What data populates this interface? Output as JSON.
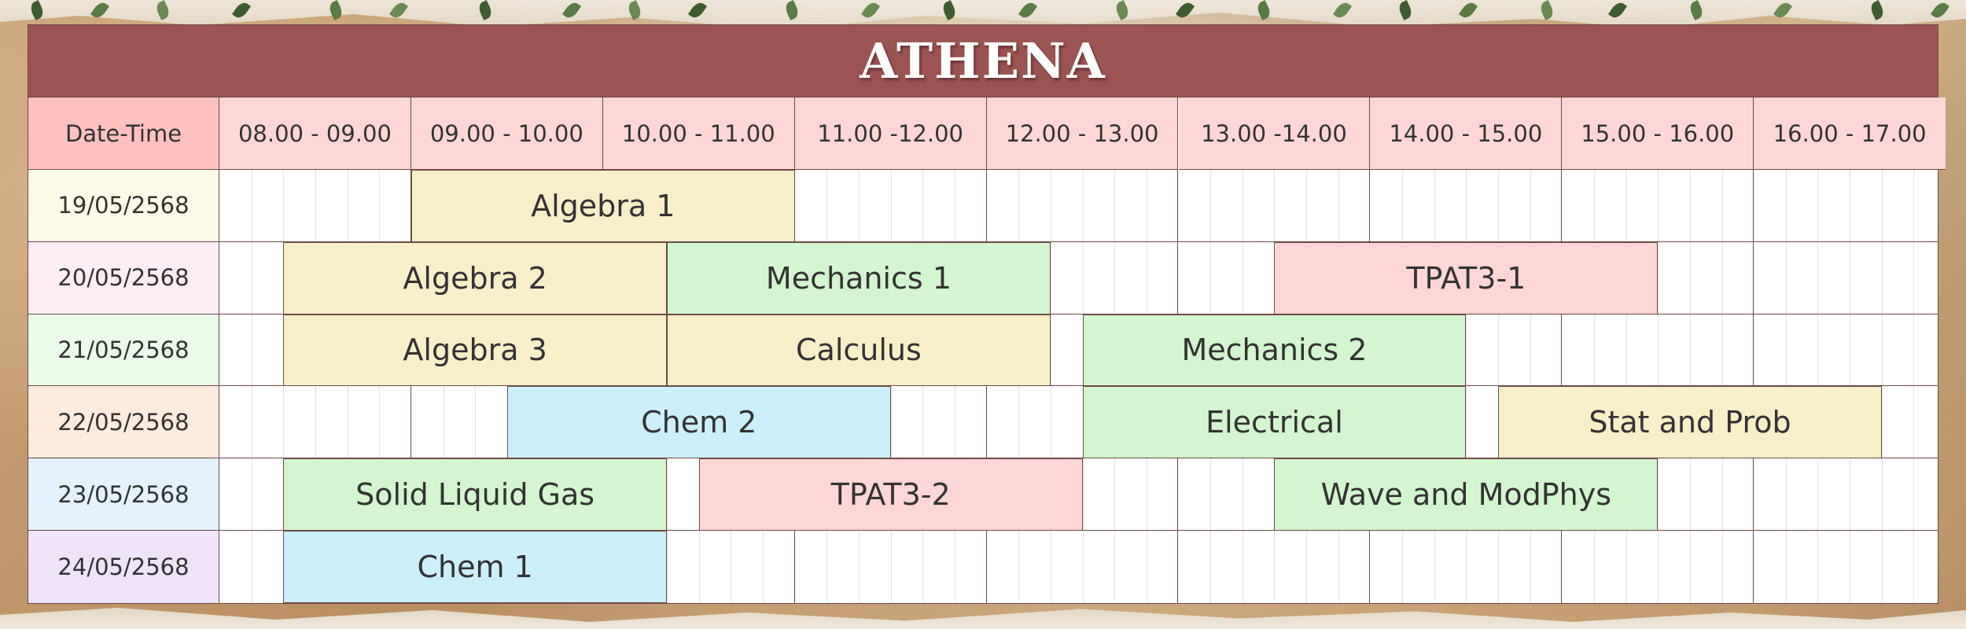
{
  "title": "ATHENA",
  "header": {
    "corner_label": "Date-Time",
    "time_slots": [
      "08.00 - 09.00",
      "09.00 - 10.00",
      "10.00 - 11.00",
      "11.00 -12.00",
      "12.00 - 13.00",
      "13.00 -14.00",
      "14.00 - 15.00",
      "15.00 - 16.00",
      "16.00 - 17.00"
    ]
  },
  "colors": {
    "title_bar": "#9b5452",
    "header": "#ffd6d6",
    "subject_yellow": "#f7efc8",
    "subject_green": "#d3f5cf",
    "subject_pink": "#ffd6d6",
    "subject_blue": "#cbeffb"
  },
  "rows": [
    {
      "date": "19/05/2568",
      "date_color": "#fdfbe8",
      "events": [
        {
          "label": "Algebra 1",
          "start": 9.0,
          "end": 11.0,
          "color": "#f7efc8"
        }
      ]
    },
    {
      "date": "20/05/2568",
      "date_color": "#fdeef6",
      "events": [
        {
          "label": "Algebra 2",
          "start": 8.333,
          "end": 10.333,
          "color": "#f7efc8"
        },
        {
          "label": "Mechanics 1",
          "start": 10.333,
          "end": 12.333,
          "color": "#d3f5cf"
        },
        {
          "label": "TPAT3-1",
          "start": 13.5,
          "end": 15.5,
          "color": "#ffd6d6"
        }
      ]
    },
    {
      "date": "21/05/2568",
      "date_color": "#eafbea",
      "events": [
        {
          "label": "Algebra 3",
          "start": 8.333,
          "end": 10.333,
          "color": "#f7efc8"
        },
        {
          "label": "Calculus",
          "start": 10.333,
          "end": 12.333,
          "color": "#f7efc8"
        },
        {
          "label": "Mechanics 2",
          "start": 12.5,
          "end": 14.5,
          "color": "#d3f5cf"
        }
      ]
    },
    {
      "date": "22/05/2568",
      "date_color": "#fdebde",
      "events": [
        {
          "label": "Chem 2",
          "start": 9.5,
          "end": 11.5,
          "color": "#cbeffb"
        },
        {
          "label": "Electrical",
          "start": 12.5,
          "end": 14.5,
          "color": "#d3f5cf"
        },
        {
          "label": "Stat and Prob",
          "start": 14.667,
          "end": 16.667,
          "color": "#f7efc8"
        }
      ]
    },
    {
      "date": "23/05/2568",
      "date_color": "#e3f2fc",
      "events": [
        {
          "label": "Solid Liquid Gas",
          "start": 8.333,
          "end": 10.333,
          "color": "#d3f5cf"
        },
        {
          "label": "TPAT3-2",
          "start": 10.5,
          "end": 12.5,
          "color": "#ffd6d6"
        },
        {
          "label": "Wave and ModPhys",
          "start": 13.5,
          "end": 15.5,
          "color": "#d3f5cf"
        }
      ]
    },
    {
      "date": "24/05/2568",
      "date_color": "#efe3fa",
      "events": [
        {
          "label": "Chem 1",
          "start": 8.333,
          "end": 10.333,
          "color": "#cbeffb"
        }
      ]
    }
  ]
}
